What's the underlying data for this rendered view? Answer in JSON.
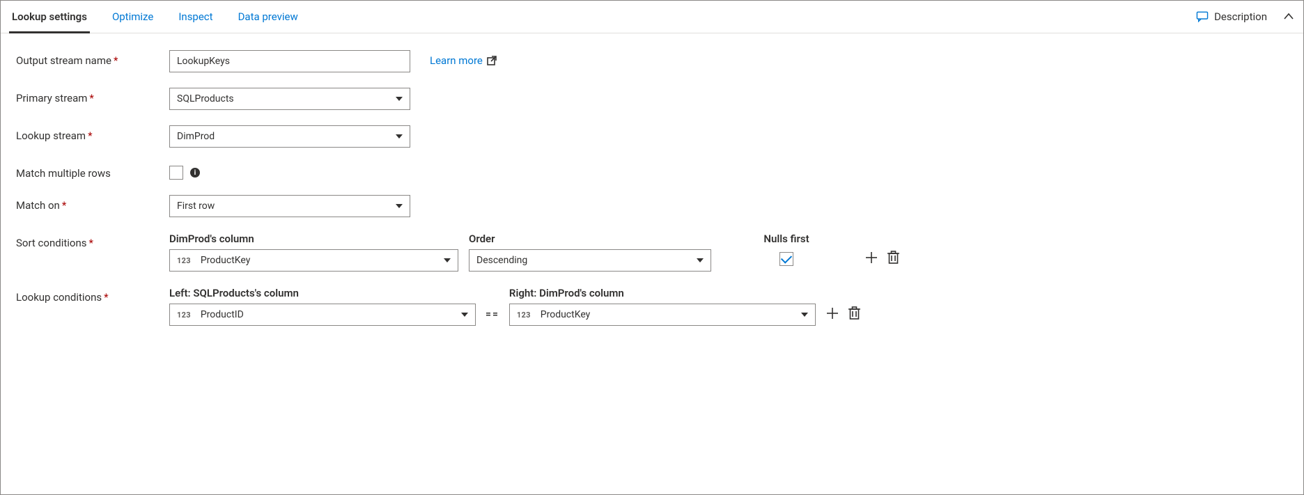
{
  "tabs": {
    "lookup_settings": "Lookup settings",
    "optimize": "Optimize",
    "inspect": "Inspect",
    "data_preview": "Data preview"
  },
  "description_label": "Description",
  "learn_more_label": "Learn more",
  "labels": {
    "output_stream_name": "Output stream name",
    "primary_stream": "Primary stream",
    "lookup_stream": "Lookup stream",
    "match_multiple_rows": "Match multiple rows",
    "match_on": "Match on",
    "sort_conditions": "Sort conditions",
    "lookup_conditions": "Lookup conditions"
  },
  "values": {
    "output_stream_name": "LookupKeys",
    "primary_stream": "SQLProducts",
    "lookup_stream": "DimProd",
    "match_multiple_rows": false,
    "match_on": "First row"
  },
  "sort": {
    "col_header": "DimProd's column",
    "order_header": "Order",
    "nulls_header": "Nulls first",
    "column_type": "123",
    "column_name": "ProductKey",
    "order_value": "Descending",
    "nulls_first": true
  },
  "lookup": {
    "left_header": "Left: SQLProducts's column",
    "right_header": "Right: DimProd's column",
    "left_type": "123",
    "left_col": "ProductID",
    "op": "==",
    "right_type": "123",
    "right_col": "ProductKey"
  }
}
